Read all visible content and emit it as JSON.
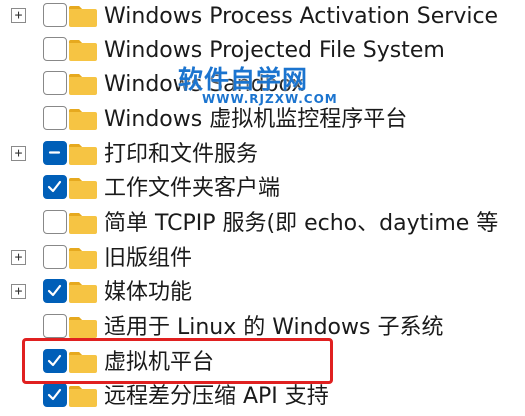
{
  "features": [
    {
      "label": "Windows Process Activation Service",
      "expander": "+",
      "state": "unchecked"
    },
    {
      "label": "Windows Projected File System",
      "expander": "",
      "state": "unchecked"
    },
    {
      "label": "Windows Sandbox",
      "expander": "",
      "state": "unchecked"
    },
    {
      "label": "Windows 虚拟机监控程序平台",
      "expander": "",
      "state": "unchecked"
    },
    {
      "label": "打印和文件服务",
      "expander": "+",
      "state": "partial"
    },
    {
      "label": "工作文件夹客户端",
      "expander": "",
      "state": "checked"
    },
    {
      "label": "简单 TCPIP 服务(即 echo、daytime 等",
      "expander": "",
      "state": "unchecked"
    },
    {
      "label": "旧版组件",
      "expander": "+",
      "state": "unchecked"
    },
    {
      "label": "媒体功能",
      "expander": "+",
      "state": "checked"
    },
    {
      "label": "适用于 Linux 的 Windows 子系统",
      "expander": "",
      "state": "unchecked"
    },
    {
      "label": "虚拟机平台",
      "expander": "",
      "state": "checked",
      "highlighted": true
    },
    {
      "label": "远程差分压缩 API 支持",
      "expander": "",
      "state": "checked"
    }
  ],
  "watermark": {
    "main": "软件自学网",
    "sub": "WWW.RJZXW.COM"
  },
  "colors": {
    "accent": "#005fb8",
    "folder": "#f6c443",
    "folder_tab": "#e6a91f",
    "highlight": "#e02020",
    "watermark": "#1b74cf"
  }
}
